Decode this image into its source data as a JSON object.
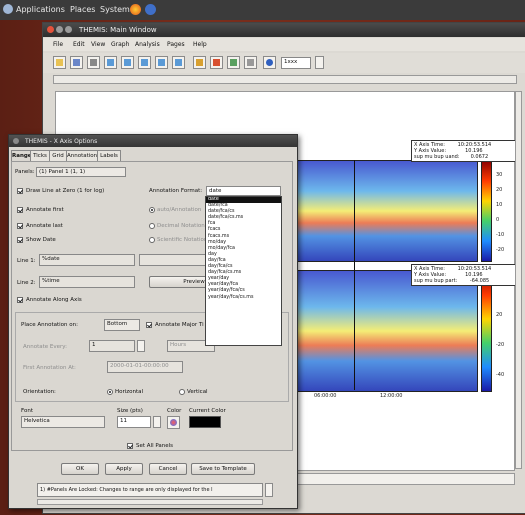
{
  "topbar": {
    "applications": "Applications",
    "places": "Places",
    "system": "System"
  },
  "main_window": {
    "title": "THEMIS: Main Window",
    "menus": [
      "File",
      "Edit",
      "View",
      "Graph",
      "Analysis",
      "Pages",
      "Help"
    ],
    "zoom_value": "1xxx",
    "plot_ticks": {
      "x": [
        "06:00:00",
        "12:00:00"
      ],
      "cbar_top": [
        "30",
        "20",
        "10",
        "0",
        "-10",
        "-20"
      ],
      "cbar_bottom": [
        "40",
        "20",
        "-20",
        "-40"
      ]
    },
    "readout_top": "X Axis Time:        10:20:53.514\nY Axis Value:            10.196\nsup mu bup uand:       0.0672",
    "readout_bottom": "X Axis Time:        10:20:53.514\nY Axis Value:            10.196\nsup mu bup part:        -64.085"
  },
  "dialog": {
    "title": "THEMIS - X Axis Options",
    "tabs": [
      "Range",
      "Ticks",
      "Grid",
      "Annotation",
      "Labels"
    ],
    "panels_label": "Panels:",
    "panels_value": "(1)  Panel 1 (1, 1)",
    "draw_line": "Draw Line at Zero (1 for log)",
    "annotate_first": "Annotate first",
    "annotate_last": "Annotate last",
    "show_date": "Show Date",
    "annotation_format_label": "Annotation Format:",
    "annotation_format_value": "date",
    "auto_annotation": "auto/Annotation",
    "decimal_notation": "Decimal Notation",
    "scientific_notation": "Scientific Notation",
    "line1_label": "Line 1:",
    "line1_value": "%date",
    "line2_label": "Line 2:",
    "line2_value": "%time",
    "preview": "Preview",
    "annotate_along_axis": "Annotate Along Axis",
    "place_annotation": "Place Annotation on:",
    "place_value": "Bottom",
    "annotate_major": "Annotate Major Ti",
    "annotate_every": "Annotate Every:",
    "annotate_every_value": "1",
    "annotate_every_unit": "Hours",
    "first_annotation": "First Annotation At:",
    "first_annotation_value": "2000-01-01-00:00:00",
    "orientation": "Orientation:",
    "horizontal": "Horizontal",
    "vertical": "Vertical",
    "font_label": "Font",
    "font_value": "Helvetica",
    "size_label": "Size (pts)",
    "size_value": "11",
    "color_label": "Color",
    "current_color_label": "Current Color",
    "set_all_panels": "Set All Panels",
    "ok": "OK",
    "apply": "Apply",
    "cancel": "Cancel",
    "save_template": "Save to Template",
    "status": "1) #Panels Are Locked: Changes to range are only displayed for the l"
  },
  "format_options": [
    "date",
    "date/fca",
    "date/fca/cs",
    "date/fca/cs.ms",
    "fca",
    "fcacs",
    "fcacs.ms",
    "mo/day",
    "mo/day/fca",
    "day",
    "day/fca",
    "day/fca/cs",
    "day/fca/cs.ms",
    "year/day",
    "year/day/fca",
    "year/day/fca/cs",
    "year/day/fca/cs.ms"
  ],
  "colors": {
    "current_color": "#000000",
    "desktop": "#6a2416",
    "selected_option": "#111111"
  }
}
